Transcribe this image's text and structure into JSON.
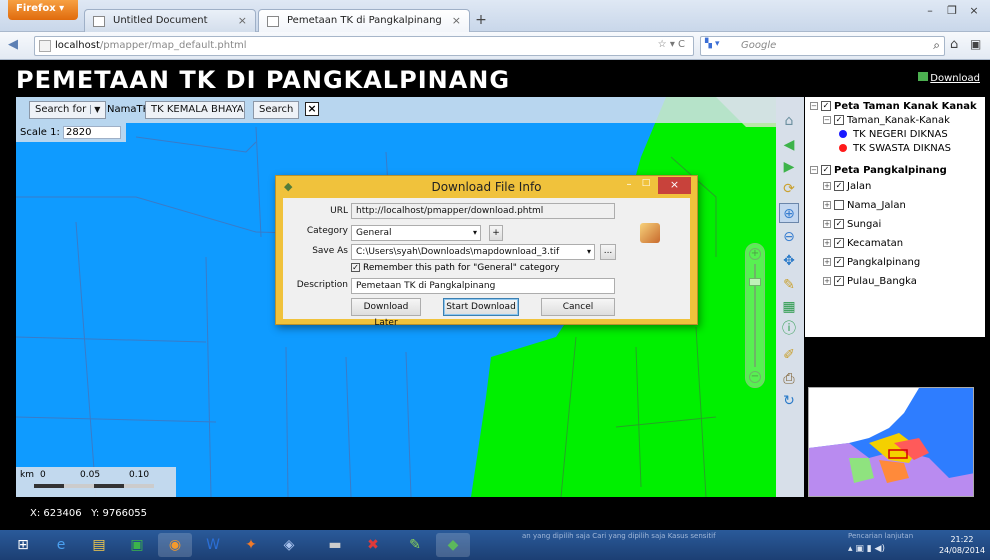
{
  "browser": {
    "firefox_label": "Firefox",
    "tabs": [
      {
        "title": "Untitled Document",
        "active": false
      },
      {
        "title": "Pemetaan TK di Pangkalpinang",
        "active": true
      }
    ],
    "url_host": "localhost",
    "url_path": "/pmapper/map_default.phtml",
    "search_engine": "Google",
    "search_placeholder": "Google"
  },
  "page": {
    "title": "PEMETAAN TK DI PANGKALPINANG",
    "download_link": "Download"
  },
  "map": {
    "search_for_label": "Search for",
    "search_field": "NamaTK",
    "search_value": "TK KEMALA BHAYA",
    "search_button": "Search",
    "scale_label": "Scale 1:",
    "scale_value": "2820",
    "scalebar_unit": "km",
    "scalebar_ticks": [
      "0",
      "0.05",
      "0.10"
    ],
    "coords_x_label": "X:",
    "coords_x": "623406",
    "coords_y_label": "Y:",
    "coords_y": "9766055"
  },
  "toc": {
    "groups": [
      {
        "label": "Peta Taman Kanak Kanak",
        "checked": true,
        "layers": [
          {
            "label": "Taman_Kanak-Kanak",
            "checked": true,
            "classes": [
              {
                "label": "TK NEGERI DIKNAS",
                "color": "#1a1aff"
              },
              {
                "label": "TK SWASTA DIKNAS",
                "color": "#ff1a1a"
              }
            ]
          }
        ]
      },
      {
        "label": "Peta Pangkalpinang",
        "checked": true,
        "layers": [
          {
            "label": "Jalan",
            "checked": true
          },
          {
            "label": "Nama_Jalan",
            "checked": false
          },
          {
            "label": "Sungai",
            "checked": true
          },
          {
            "label": "Kecamatan",
            "checked": true
          },
          {
            "label": "Pangkalpinang",
            "checked": true
          },
          {
            "label": "Pulau_Bangka",
            "checked": true
          }
        ]
      }
    ]
  },
  "dialog": {
    "title": "Download File Info",
    "url_label": "URL",
    "url_value": "http://localhost/pmapper/download.phtml",
    "category_label": "Category",
    "category_value": "General",
    "saveas_label": "Save As",
    "saveas_value": "C:\\Users\\syah\\Downloads\\mapdownload_3.tif",
    "remember_label": "Remember this path for \"General\" category",
    "remember_checked": true,
    "description_label": "Description",
    "description_value": "Pemetaan TK di Pangkalpinang",
    "btn_later": "Download Later",
    "btn_start": "Start Download",
    "btn_cancel": "Cancel",
    "btn_add": "+",
    "btn_browse": "..."
  },
  "taskbar": {
    "tray_text": "an yang dipilih saja    Cari yang dipilih saja    Kasus sensitif",
    "tray_search": "Pencarian lanjutan",
    "time": "21:22",
    "date": "24/08/2014"
  },
  "colors": {
    "water": "#0f9bff",
    "land": "#00f000",
    "dialog_frame": "#f0c23c",
    "page_bg": "#000000"
  }
}
